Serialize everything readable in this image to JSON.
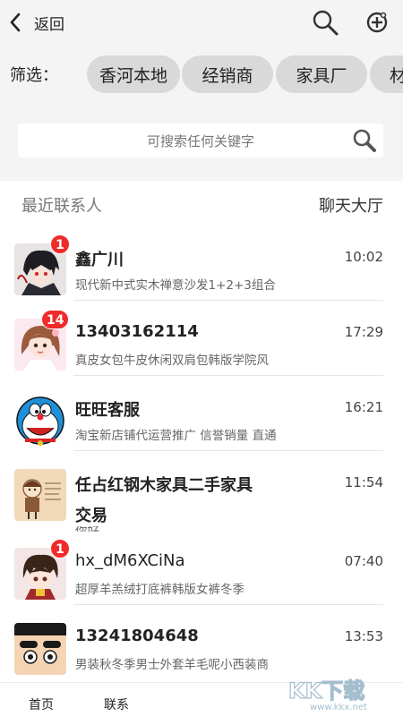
{
  "header": {
    "back_label": "返回"
  },
  "filter": {
    "label": "筛选：",
    "chips": [
      "香河本地",
      "经销商",
      "家具厂",
      "材"
    ]
  },
  "search": {
    "placeholder": "可搜索任何关键字"
  },
  "section": {
    "title": "最近联系人",
    "lobby_link": "聊天大厅"
  },
  "contacts": [
    {
      "name": "鑫广川",
      "time": "10:02",
      "message": "现代新中式实木禅意沙发1+2+3组合",
      "badge": "1"
    },
    {
      "name": "13403162114",
      "time": "17:29",
      "message": "真皮女包牛皮休闲双肩包韩版学院风",
      "badge": "14"
    },
    {
      "name": "旺旺客服",
      "time": "16:21",
      "message": "淘宝新店铺代运营推广 信誉销量 直通",
      "badge": ""
    },
    {
      "name": "任占红钢木家具二手家具",
      "name_wrap": "交易",
      "time": "11:54",
      "message": "你好",
      "badge": ""
    },
    {
      "name": "hx_dM6XCiNa",
      "time": "07:40",
      "message": "超厚羊羔绒打底裤韩版女裤冬季",
      "badge": "1"
    },
    {
      "name": "13241804648",
      "time": "13:53",
      "message": "男装秋冬季男士外套羊毛呢小西装商",
      "badge": ""
    }
  ],
  "tabbar": {
    "tab_home": "首页",
    "tab_second": "联系"
  },
  "watermark": {
    "text": "KK下载",
    "url": "www.kkx.net"
  },
  "colors": {
    "badge": "#ef2b2b",
    "header_bg": "#f4f4f4",
    "chip_bg": "#d9d9d9"
  }
}
